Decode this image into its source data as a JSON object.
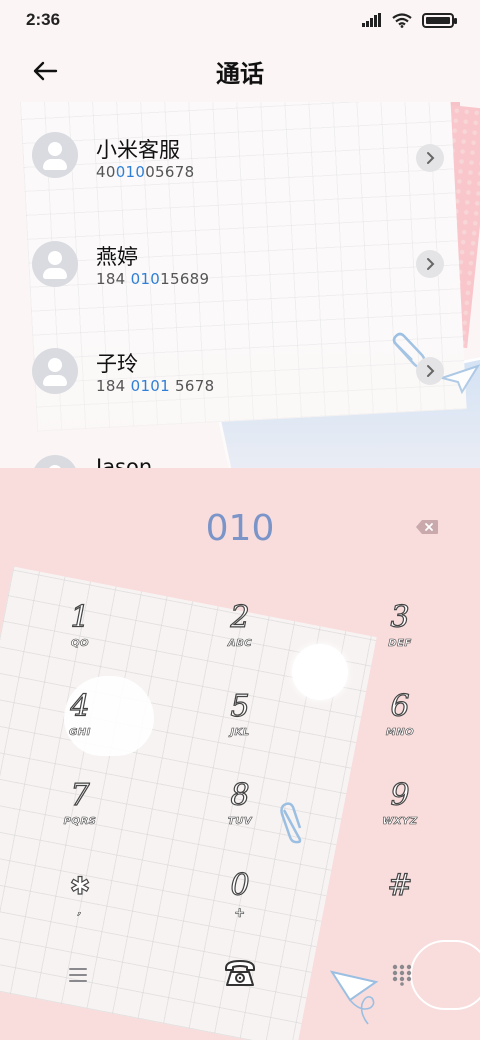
{
  "status_bar": {
    "time": "2:36"
  },
  "header": {
    "title": "通话"
  },
  "contacts": [
    {
      "name": "小米客服",
      "number_parts": [
        "40",
        "010",
        "05678"
      ]
    },
    {
      "name": "燕婷",
      "number_parts": [
        "184 ",
        "010",
        "15689"
      ]
    },
    {
      "name": "子玲",
      "number_parts": [
        "184 ",
        "0101",
        " 5678"
      ]
    },
    {
      "name": "Jason",
      "number_parts": [
        "",
        "",
        ""
      ]
    }
  ],
  "dialer": {
    "input_value": "010",
    "keys": [
      {
        "digit": "1",
        "letters": "QO"
      },
      {
        "digit": "2",
        "letters": "ABC"
      },
      {
        "digit": "3",
        "letters": "DEF"
      },
      {
        "digit": "4",
        "letters": "GHI"
      },
      {
        "digit": "5",
        "letters": "JKL"
      },
      {
        "digit": "6",
        "letters": "MNO"
      },
      {
        "digit": "7",
        "letters": "PQRS"
      },
      {
        "digit": "8",
        "letters": "TUV"
      },
      {
        "digit": "9",
        "letters": "WXYZ"
      },
      {
        "digit": "✱",
        "letters": ","
      },
      {
        "digit": "0",
        "letters": "+"
      },
      {
        "digit": "#",
        "letters": ""
      }
    ]
  },
  "colors": {
    "highlight": "#2f7fd6",
    "dial_text": "#7b95c9",
    "dialpad_bg": "#f9dcdc"
  },
  "icons": {
    "back": "arrow-left-icon",
    "detail": "chevron-right-icon",
    "delete": "backspace-icon",
    "menu": "menu-icon",
    "call": "telephone-icon",
    "keypad": "keypad-icon"
  }
}
